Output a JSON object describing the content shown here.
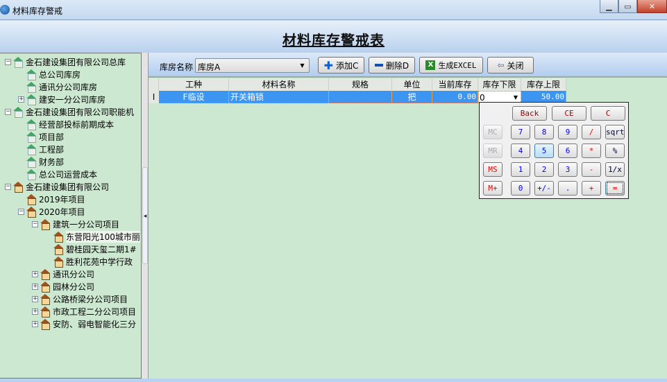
{
  "window": {
    "title": "材料库存警戒",
    "controls": [
      "minimize",
      "maximize",
      "close"
    ]
  },
  "header": {
    "title": "材料库存警戒表"
  },
  "tree": [
    {
      "label": "金石建设集团有限公司总库",
      "level": 0,
      "expander": "−",
      "icon": "green"
    },
    {
      "label": "总公司库房",
      "level": 1,
      "icon": "green"
    },
    {
      "label": "通讯分公司库房",
      "level": 1,
      "icon": "green"
    },
    {
      "label": "建安一分公司库房",
      "level": 1,
      "expander": "+",
      "icon": "green"
    },
    {
      "label": "金石建设集团有限公司职能机",
      "level": 0,
      "expander": "−",
      "icon": "green"
    },
    {
      "label": "经营部投标前期成本",
      "level": 1,
      "icon": "green"
    },
    {
      "label": "项目部",
      "level": 1,
      "icon": "green"
    },
    {
      "label": "工程部",
      "level": 1,
      "icon": "green"
    },
    {
      "label": "财务部",
      "level": 1,
      "icon": "green"
    },
    {
      "label": "总公司运营成本",
      "level": 1,
      "icon": "green"
    },
    {
      "label": "金石建设集团有限公司",
      "level": 0,
      "expander": "−",
      "icon": "orange"
    },
    {
      "label": "2019年项目",
      "level": 1,
      "icon": "orange"
    },
    {
      "label": "2020年项目",
      "level": 1,
      "expander": "−",
      "icon": "orange"
    },
    {
      "label": "建筑一分公司项目",
      "level": 2,
      "expander": "−",
      "icon": "orange"
    },
    {
      "label": "东营阳光100城市丽",
      "level": 3,
      "icon": "orange",
      "selected": true
    },
    {
      "label": "碧桂园天玺二期1#",
      "level": 3,
      "icon": "orange"
    },
    {
      "label": "胜利花苑中学行政",
      "level": 3,
      "icon": "orange"
    },
    {
      "label": "通讯分公司",
      "level": 2,
      "expander": "+",
      "icon": "orange"
    },
    {
      "label": "园林分公司",
      "level": 2,
      "expander": "+",
      "icon": "orange"
    },
    {
      "label": "公路桥梁分公司项目",
      "level": 2,
      "expander": "+",
      "icon": "orange"
    },
    {
      "label": "市政工程二分公司项目",
      "level": 2,
      "expander": "+",
      "icon": "orange"
    },
    {
      "label": "安防、弱电智能化三分",
      "level": 2,
      "expander": "+",
      "icon": "orange"
    }
  ],
  "toolbar": {
    "warehouse_label": "库房名称",
    "warehouse_value": "库房A",
    "add": "添加C",
    "delete": "删除D",
    "excel": "生成EXCEL",
    "close": "关闭"
  },
  "grid": {
    "columns": [
      "",
      "工种",
      "材料名称",
      "规格",
      "单位",
      "当前库存",
      "库存下限",
      "库存上限"
    ],
    "rows": [
      [
        "I",
        "F临设",
        "开关箱锁",
        "",
        "把",
        "0.00",
        "0",
        "50.00"
      ]
    ]
  },
  "calculator": {
    "top": [
      "Back",
      "CE",
      "C"
    ],
    "memory": [
      "MC",
      "MR",
      "MS",
      "M+"
    ],
    "keys": [
      [
        "7",
        "8",
        "9",
        "/",
        "sqrt"
      ],
      [
        "4",
        "5",
        "6",
        "*",
        "%"
      ],
      [
        "1",
        "2",
        "3",
        "-",
        "1/x"
      ],
      [
        "0",
        "+/-",
        ".",
        "+",
        "="
      ]
    ]
  },
  "colors": {
    "tree_bg": "#cde8d0",
    "selection": "#3c95f0",
    "title_bar": "#c3d8ef"
  }
}
